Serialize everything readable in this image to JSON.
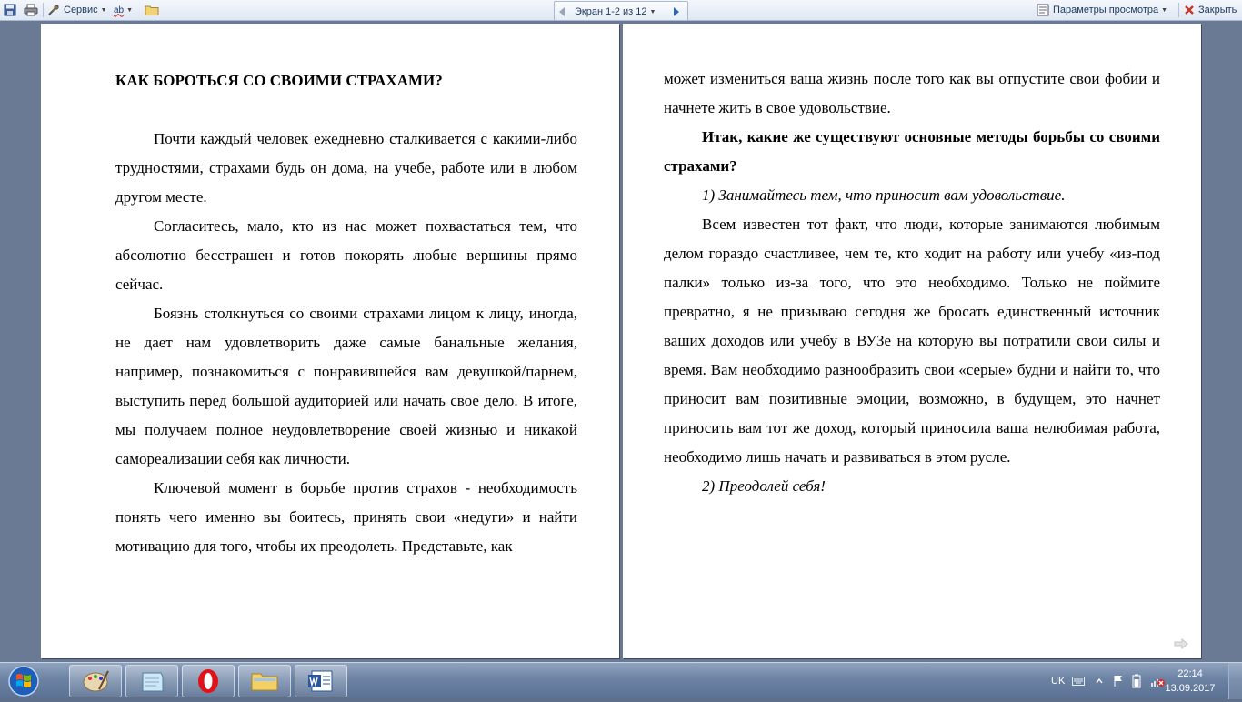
{
  "toolbar": {
    "service_label": "Сервис",
    "screen_label": "Экран 1-2 из 12",
    "view_options_label": "Параметры просмотра",
    "close_label": "Закрыть",
    "abc_label": "ab"
  },
  "left_page": {
    "title": "КАК БОРОТЬСЯ СО СВОИМИ СТРАХАМИ?",
    "paragraphs": [
      "Почти каждый человек ежедневно сталкивается с какими-либо трудностями, страхами будь он дома, на учебе, работе или в любом другом месте.",
      "Согласитесь, мало, кто из нас может похвастаться тем, что абсолютно бесстрашен и готов покорять любые вершины прямо сейчас.",
      "Боязнь столкнуться со своими страхами лицом к лицу, иногда, не дает нам удовлетворить даже самые банальные желания, например, познакомиться с понравившейся вам девушкой/парнем, выступить перед большой аудиторией или начать свое дело. В итоге, мы получаем полное неудовлетворение своей жизнью и никакой самореализации себя как личности.",
      "Ключевой момент в борьбе против страхов - необходимость понять чего именно вы боитесь, принять свои «недуги» и найти мотивацию для того, чтобы их преодолеть. Представьте, как"
    ]
  },
  "right_page": {
    "continuation": "может измениться ваша жизнь после того как вы отпустите свои фобии и начнете жить в свое удовольствие.",
    "heading": "Итак, какие же существуют основные методы борьбы со своими страхами?",
    "item1": "1) Занимайтесь тем, что приносит вам удовольствие.",
    "body": "Всем известен тот факт, что люди, которые занимаются любимым делом гораздо счастливее, чем те, кто ходит на работу или  учебу «из-под палки»  только из-за того, что это необходимо. Только не поймите превратно, я не призываю сегодня же бросать единственный источник ваших доходов или учебу в ВУЗе на которую вы потратили свои силы и время. Вам необходимо разнообразить свои «серые» будни и найти то, что приносит вам позитивные эмоции, возможно, в будущем, это начнет приносить вам тот же доход, который приносила ваша нелюбимая работа, необходимо лишь начать и развиваться в этом русле.",
    "item2": "2) Преодолей себя!"
  },
  "taskbar": {
    "language": "UK",
    "time": "22:14",
    "date": "13.09.2017"
  }
}
